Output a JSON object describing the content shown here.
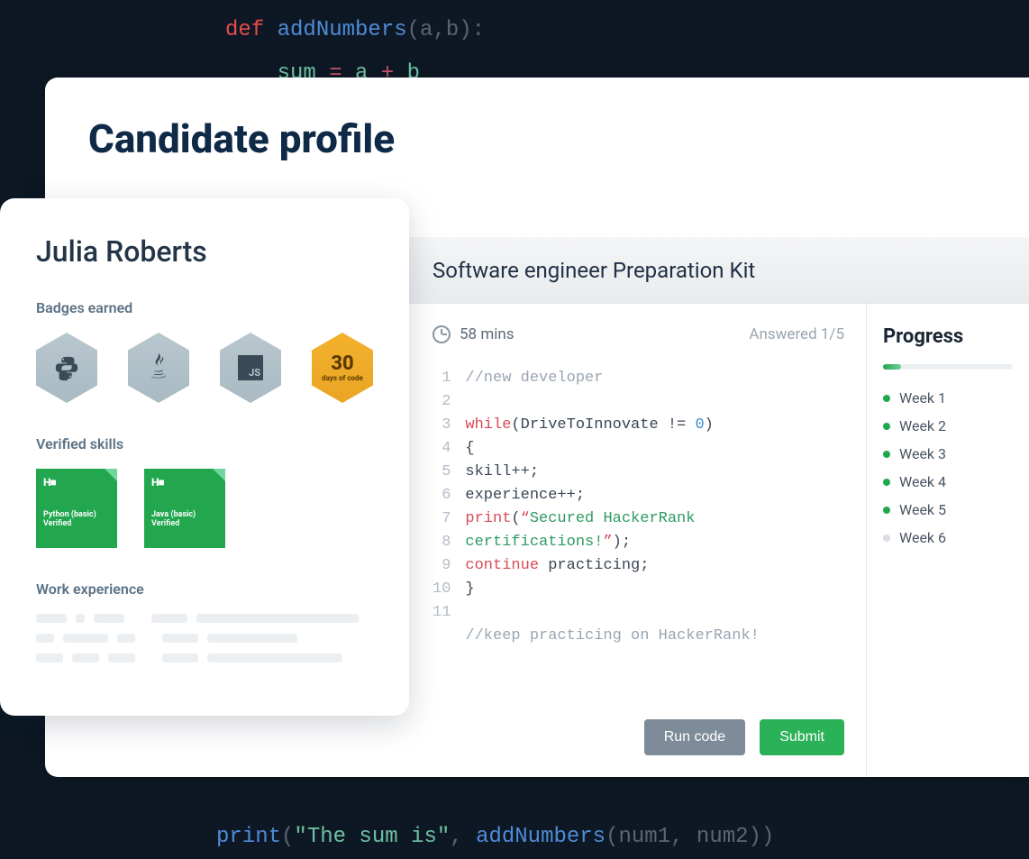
{
  "bg_code": {
    "line1_kw": "def ",
    "line1_fn": "addNumbers",
    "line1_rest": "(a,b):",
    "line2_id1": "sum",
    "line2_op": " = ",
    "line2_id2": "a",
    "line2_plus": " + ",
    "line2_id3": "b",
    "bottom_fn": "print",
    "bottom_open": "(",
    "bottom_str": "\"The sum is\"",
    "bottom_sep": ", ",
    "bottom_call": "addNumbers",
    "bottom_args": "(num1, num2)",
    "bottom_close": ")"
  },
  "page_title": "Candidate profile",
  "profile": {
    "name": "Julia Roberts",
    "badges_label": "Badges earned",
    "badges": {
      "python": "python-icon",
      "java": "java-icon",
      "js": "JS",
      "days_number": "30",
      "days_label": "days of code"
    },
    "skills_label": "Verified skills",
    "skills": [
      {
        "logo": "H■",
        "name": "Python (basic)",
        "status": "Verified"
      },
      {
        "logo": "H■",
        "name": "Java (basic)",
        "status": "Verified"
      }
    ],
    "work_label": "Work experience"
  },
  "kit": {
    "title": "Software engineer Preparation Kit",
    "time": "58 mins",
    "answered": "Answered 1/5",
    "run_label": "Run code",
    "submit_label": "Submit",
    "code": {
      "l1": "//new developer",
      "l2": "",
      "l3_kw": "while",
      "l3_mid": "(DriveToInnovate != ",
      "l3_num": "0",
      "l3_end": ")",
      "l4": "{",
      "l5": "skill++;",
      "l6": "experience++;",
      "l7_fn": "print",
      "l7_open": "(",
      "l7_q1": "“",
      "l7_str": "Secured HackerRank certifications!",
      "l7_q2": "”",
      "l7_close": ");",
      "l8_kw": "continue",
      "l8_rest": " practicing;",
      "l9": "}",
      "l10": "",
      "l11": "//keep practicing on HackerRank!"
    },
    "progress": {
      "title": "Progress",
      "percent": 14,
      "weeks": [
        {
          "label": "Week 1",
          "done": true
        },
        {
          "label": "Week 2",
          "done": true
        },
        {
          "label": "Week 3",
          "done": true
        },
        {
          "label": "Week 4",
          "done": true
        },
        {
          "label": "Week 5",
          "done": true
        },
        {
          "label": "Week 6",
          "done": false
        }
      ]
    }
  }
}
